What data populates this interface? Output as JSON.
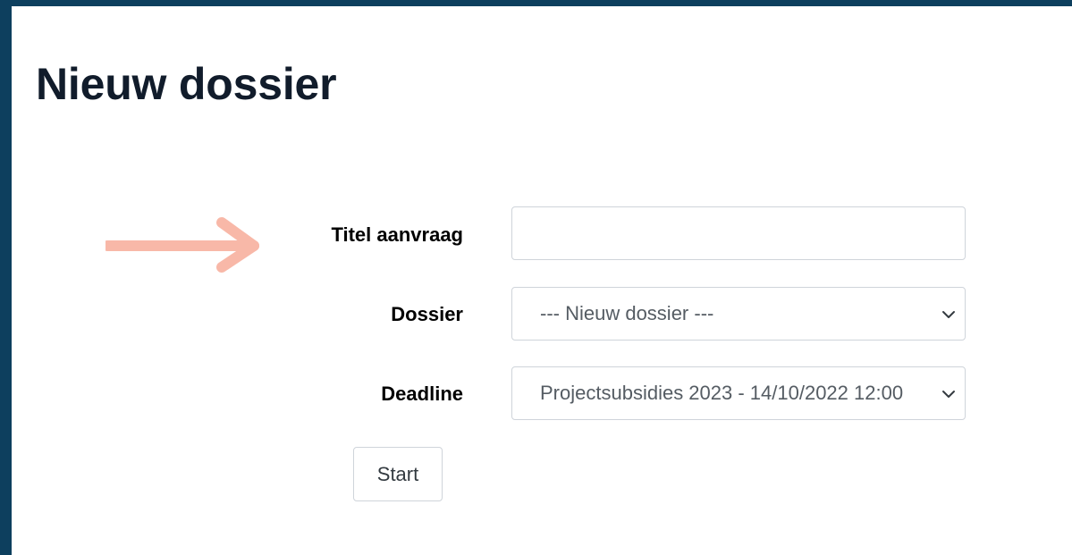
{
  "page": {
    "title": "Nieuw dossier"
  },
  "form": {
    "title_field": {
      "label": "Titel aanvraag",
      "value": ""
    },
    "dossier_field": {
      "label": "Dossier",
      "selected": "--- Nieuw dossier ---"
    },
    "deadline_field": {
      "label": "Deadline",
      "selected": "Projectsubsidies 2023 - 14/10/2022 12:00"
    },
    "start_label": "Start"
  },
  "colors": {
    "frame": "#0d3f5e",
    "background": "#ffffff",
    "title_text": "#111c2b",
    "arrow": "#f8b8a8",
    "control_border": "#cfd4da"
  },
  "icons": {
    "pointer_arrow": "arrow-right-icon",
    "select_caret": "chevron-down-icon"
  }
}
